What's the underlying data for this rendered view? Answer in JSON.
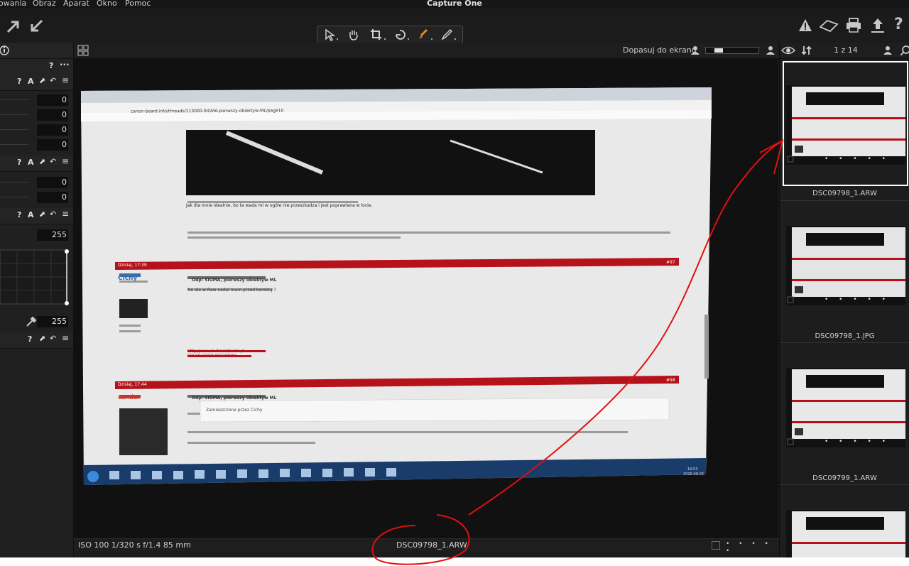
{
  "app": {
    "title": "Capture One"
  },
  "menu": [
    "owania",
    "Obraz",
    "Aparat",
    "Okno",
    "Pomoc"
  ],
  "toolbar": {
    "left_icons": [
      "import-arrow-icon",
      "export-arrow-icon"
    ],
    "tools": [
      "cursor-tool-icon",
      "pan-hand-icon",
      "crop-tool-icon",
      "rotate-tool-icon",
      "brush-tool-icon",
      "pen-tool-icon"
    ],
    "right_icons": [
      "warning-icon",
      "eraser-icon",
      "print-icon",
      "upload-icon",
      "help-icon"
    ]
  },
  "left_panel": {
    "top_icons": [
      "info-icon",
      "help",
      "more"
    ],
    "help": "?",
    "more": "···",
    "section1_icons": "? A",
    "section1_values": [
      "0",
      "0",
      "0",
      "0"
    ],
    "section2_icons": "? A",
    "section2_values": [
      "0",
      "0"
    ],
    "section3_icons": "? A",
    "section3_value_top": "255",
    "section3_value_bottom": "255",
    "section4_icons": "?"
  },
  "viewer_header": {
    "fit_label": "Dopasuj do ekranu",
    "counter": "1 z 14"
  },
  "status": {
    "exif": "ISO 100  1/320 s  f/1.4  85 mm",
    "filename": "DSC09798_1.ARW",
    "dots": "• • • • •"
  },
  "browser": {
    "thumbs": [
      {
        "label": "DSC09798_1.ARW",
        "selected": true
      },
      {
        "label": "DSC09798_1.JPG",
        "selected": false
      },
      {
        "label": "DSC09799_1.ARW",
        "selected": false
      },
      {
        "label": "",
        "selected": false
      }
    ],
    "dots": "• • • • •"
  },
  "photo_content": {
    "url": "canon-board.info/threads/113000-SIGMA-pierwszy-obiektyw-ML/page10",
    "post1_date": "Dzisiaj, 17:39",
    "post1_num": "#97",
    "post1_user": "Cichy",
    "post1_title": "Odp: SIGMA, pierwszy obiektyw ML",
    "post1_text": "No ale w Raw nadal mam przed korektą ?",
    "post1_link": "http://www.kubacichocki.pl",
    "post1_link2": "SKLEP FOTO NEGATYW",
    "post2_date": "Dzisiaj, 17:44",
    "post2_num": "#98",
    "post2_user": "candar",
    "post2_title": "Odp: SIGMA, pierwszy obiektyw ML",
    "post2_quote": "Zamieszczone przez Cichy",
    "earlier_text": "Jak dla mnie idealnie, bo ta wada mi w ogóle nie przeszkadza i jest poprawiana w locie.",
    "taskbar_time": "19:53",
    "taskbar_date": "2020-09-02"
  },
  "colors": {
    "annotation_red": "#e01010",
    "forum_red": "#b5121b",
    "selection_white": "#ffffff"
  }
}
